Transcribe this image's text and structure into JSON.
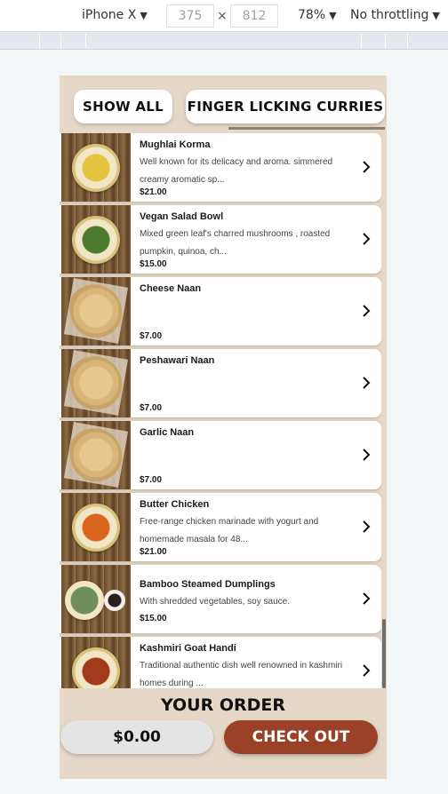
{
  "devtools": {
    "device": "iPhone X",
    "width": "375",
    "height": "812",
    "zoom": "78%",
    "throttling": "No throttling",
    "times_symbol": "×",
    "caret": "▼"
  },
  "categories": [
    {
      "label": "SHOW ALL"
    },
    {
      "label": "FINGER LICKING CURRIES"
    }
  ],
  "menu_items": [
    {
      "name": "Mughlai Korma",
      "description": "Well known for its delicacy and aroma. simmered creamy aromatic sp...",
      "price": "$21.00",
      "image": "curry-bowl",
      "food_color": "#e7c23f"
    },
    {
      "name": "Vegan Salad Bowl",
      "description": "Mixed green leaf's charred mushrooms , roasted pumpkin, quinoa, ch...",
      "price": "$15.00",
      "image": "salad-bowl",
      "food_color": "#4d7a2e"
    },
    {
      "name": "Cheese Naan",
      "description": "",
      "price": "$7.00",
      "image": "naan",
      "food_color": "#e2c07e"
    },
    {
      "name": "Peshawari Naan",
      "description": "",
      "price": "$7.00",
      "image": "naan",
      "food_color": "#e2c07e"
    },
    {
      "name": "Garlic Naan",
      "description": "",
      "price": "$7.00",
      "image": "naan",
      "food_color": "#e2c07e"
    },
    {
      "name": "Butter Chicken",
      "description": "Free-range chicken marinade with yogurt and homemade masala for 48...",
      "price": "$21.00",
      "image": "curry-bowl",
      "food_color": "#d9651f"
    },
    {
      "name": "Bamboo Steamed Dumplings",
      "description": "With shredded vegetables, soy sauce.",
      "price": "$15.00",
      "image": "dumpling-plate",
      "food_color": "#6e8f5a"
    },
    {
      "name": "Kashmiri Goat Handi",
      "description": "Traditional authentic dish well renowned in kashmiri homes during ...",
      "price": "",
      "image": "curry-bowl",
      "food_color": "#a23a1c"
    }
  ],
  "order": {
    "heading": "YOUR ORDER",
    "total": "$0.00",
    "checkout_label": "CHECK OUT"
  },
  "colors": {
    "app_background": "#e6d8c7",
    "checkout": "#9a4128",
    "total_pill": "#e4e4e4"
  }
}
